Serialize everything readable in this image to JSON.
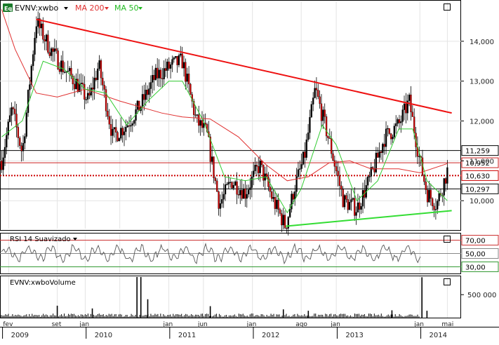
{
  "header": {
    "eq_badge": "Eq",
    "symbol_label": "EVNV:xwbo",
    "ma200_label": "MA 200",
    "ma50_label": "MA 50"
  },
  "rsi_panel": {
    "title": "RSI 14 Suavizado"
  },
  "volume_panel": {
    "title": "EVNV:xwboVolume",
    "tick_label": "500 000"
  },
  "colors": {
    "candle_up": "#000000",
    "candle_down": "#cc0000",
    "ma200": "#e03030",
    "ma50": "#33cc33",
    "trend_resistance": "#ee1111",
    "trend_support": "#33dd33",
    "rsi_line": "#555555",
    "rsi_overbought": "#cc3333",
    "rsi_oversold": "#339933",
    "axis_text": "#222222"
  },
  "icons": [
    "eq-badge-icon",
    "dropdown-triangle-icon",
    "maximize-square-icon"
  ],
  "chart_data": [
    {
      "type": "candlestick",
      "title": "EVNV:xwbo",
      "ylim": [
        9.3,
        15.0
      ],
      "y_ticks": [
        "14,000",
        "13,000",
        "12,000",
        "11,000",
        "10,000"
      ],
      "y_tick_values": [
        14.0,
        13.0,
        12.0,
        11.0,
        10.0
      ],
      "x_tick_labels": [
        "fev",
        "set",
        "jan",
        "jan",
        "jun",
        "jan",
        "ago",
        "jan",
        "jan",
        "mai"
      ],
      "x_year_labels": [
        "2009",
        "2010",
        "2011",
        "2012",
        "2013",
        "2014"
      ],
      "price_path": [
        [
          "2009-01-01",
          11.0
        ],
        [
          "2009-02-15",
          12.3
        ],
        [
          "2009-04-01",
          11.2
        ],
        [
          "2009-06-01",
          14.5
        ],
        [
          "2009-08-01",
          13.8
        ],
        [
          "2009-10-01",
          13.3
        ],
        [
          "2009-12-01",
          12.9
        ],
        [
          "2010-01-15",
          12.5
        ],
        [
          "2010-03-01",
          13.4
        ],
        [
          "2010-05-01",
          11.6
        ],
        [
          "2010-07-01",
          11.9
        ],
        [
          "2010-09-01",
          12.4
        ],
        [
          "2010-11-01",
          13.1
        ],
        [
          "2011-01-15",
          13.4
        ],
        [
          "2011-03-01",
          13.5
        ],
        [
          "2011-05-01",
          12.0
        ],
        [
          "2011-06-15",
          11.7
        ],
        [
          "2011-08-10",
          9.9
        ],
        [
          "2011-10-01",
          10.5
        ],
        [
          "2011-12-01",
          10.2
        ],
        [
          "2012-02-01",
          10.9
        ],
        [
          "2012-04-01",
          10.0
        ],
        [
          "2012-05-25",
          9.35
        ],
        [
          "2012-07-01",
          10.3
        ],
        [
          "2012-08-15",
          11.1
        ],
        [
          "2012-10-01",
          12.8
        ],
        [
          "2012-12-01",
          11.5
        ],
        [
          "2013-02-01",
          10.0
        ],
        [
          "2013-04-01",
          9.8
        ],
        [
          "2013-06-01",
          10.6
        ],
        [
          "2013-08-01",
          11.6
        ],
        [
          "2013-10-01",
          11.9
        ],
        [
          "2013-11-15",
          12.5
        ],
        [
          "2014-01-01",
          11.0
        ],
        [
          "2014-02-01",
          10.2
        ],
        [
          "2014-03-15",
          9.9
        ],
        [
          "2014-05-01",
          10.75
        ]
      ],
      "ma200": [
        [
          "2009-01-01",
          14.8
        ],
        [
          "2009-03-01",
          13.8
        ],
        [
          "2009-06-01",
          12.7
        ],
        [
          "2009-09-01",
          12.6
        ],
        [
          "2010-01-01",
          12.8
        ],
        [
          "2010-06-01",
          12.5
        ],
        [
          "2010-12-01",
          12.2
        ],
        [
          "2011-03-01",
          12.1
        ],
        [
          "2011-07-01",
          12.05
        ],
        [
          "2011-11-01",
          11.6
        ],
        [
          "2012-03-01",
          10.9
        ],
        [
          "2012-06-01",
          10.5
        ],
        [
          "2012-09-01",
          10.6
        ],
        [
          "2012-12-01",
          10.95
        ],
        [
          "2013-03-01",
          11.0
        ],
        [
          "2013-06-01",
          10.8
        ],
        [
          "2013-10-01",
          10.8
        ],
        [
          "2014-01-01",
          10.7
        ],
        [
          "2014-05-01",
          10.93
        ]
      ],
      "ma50": [
        [
          "2009-01-01",
          11.6
        ],
        [
          "2009-04-01",
          12.0
        ],
        [
          "2009-07-01",
          13.5
        ],
        [
          "2009-10-01",
          13.3
        ],
        [
          "2010-01-01",
          12.8
        ],
        [
          "2010-04-01",
          12.7
        ],
        [
          "2010-07-01",
          11.9
        ],
        [
          "2010-10-01",
          12.5
        ],
        [
          "2011-01-01",
          13.0
        ],
        [
          "2011-03-01",
          13.0
        ],
        [
          "2011-06-01",
          12.0
        ],
        [
          "2011-09-01",
          10.6
        ],
        [
          "2011-12-01",
          10.5
        ],
        [
          "2012-03-01",
          10.6
        ],
        [
          "2012-06-01",
          9.7
        ],
        [
          "2012-08-01",
          10.3
        ],
        [
          "2012-11-01",
          11.9
        ],
        [
          "2013-01-01",
          11.4
        ],
        [
          "2013-04-01",
          10.0
        ],
        [
          "2013-07-01",
          10.5
        ],
        [
          "2013-10-01",
          11.8
        ],
        [
          "2013-12-01",
          11.8
        ],
        [
          "2014-02-01",
          10.5
        ],
        [
          "2014-05-01",
          10.0
        ]
      ],
      "trendlines": [
        {
          "kind": "resistance",
          "from": [
            "2009-06-01",
            14.55
          ],
          "to": [
            "2014-05-20",
            12.2
          ]
        },
        {
          "kind": "support",
          "from": [
            "2012-05-25",
            9.36
          ],
          "to": [
            "2014-05-20",
            9.75
          ]
        }
      ],
      "levels": [
        {
          "value": 11.259,
          "label": "11,259",
          "color": "#000000",
          "style": "solid"
        },
        {
          "value": 10.952,
          "label": "10,952",
          "color": "#cc2222",
          "style": "solid"
        },
        {
          "value": 10.63,
          "label": "10,630",
          "color": "#cc0000",
          "style": "dotted"
        },
        {
          "value": 10.297,
          "label": "10,297",
          "color": "#000000",
          "style": "solid"
        }
      ],
      "grid": true
    },
    {
      "type": "line",
      "title": "RSI 14 Suavizado",
      "ylim": [
        20,
        80
      ],
      "levels": [
        {
          "value": 70,
          "label": "70,00",
          "color": "#cc3333"
        },
        {
          "value": 50,
          "label": "50,00",
          "color": "#888888"
        },
        {
          "value": 30,
          "label": "30,00",
          "color": "#339933"
        }
      ],
      "range": [
        35,
        68
      ]
    },
    {
      "type": "bar",
      "title": "EVNV:xwboVolume",
      "ylim": [
        0,
        900000
      ],
      "y_ticks": [
        "500 000"
      ],
      "y_tick_values": [
        500000
      ],
      "spikes": [
        [
          "2009-09-01",
          260000
        ],
        [
          "2010-02-01",
          200000
        ],
        [
          "2010-08-15",
          950000
        ],
        [
          "2010-09-01",
          900000
        ],
        [
          "2010-10-01",
          400000
        ],
        [
          "2011-07-01",
          250000
        ],
        [
          "2012-05-15",
          180000
        ],
        [
          "2012-09-01",
          150000
        ],
        [
          "2013-09-01",
          160000
        ],
        [
          "2014-01-10",
          880000
        ],
        [
          "2014-02-01",
          150000
        ]
      ]
    }
  ]
}
